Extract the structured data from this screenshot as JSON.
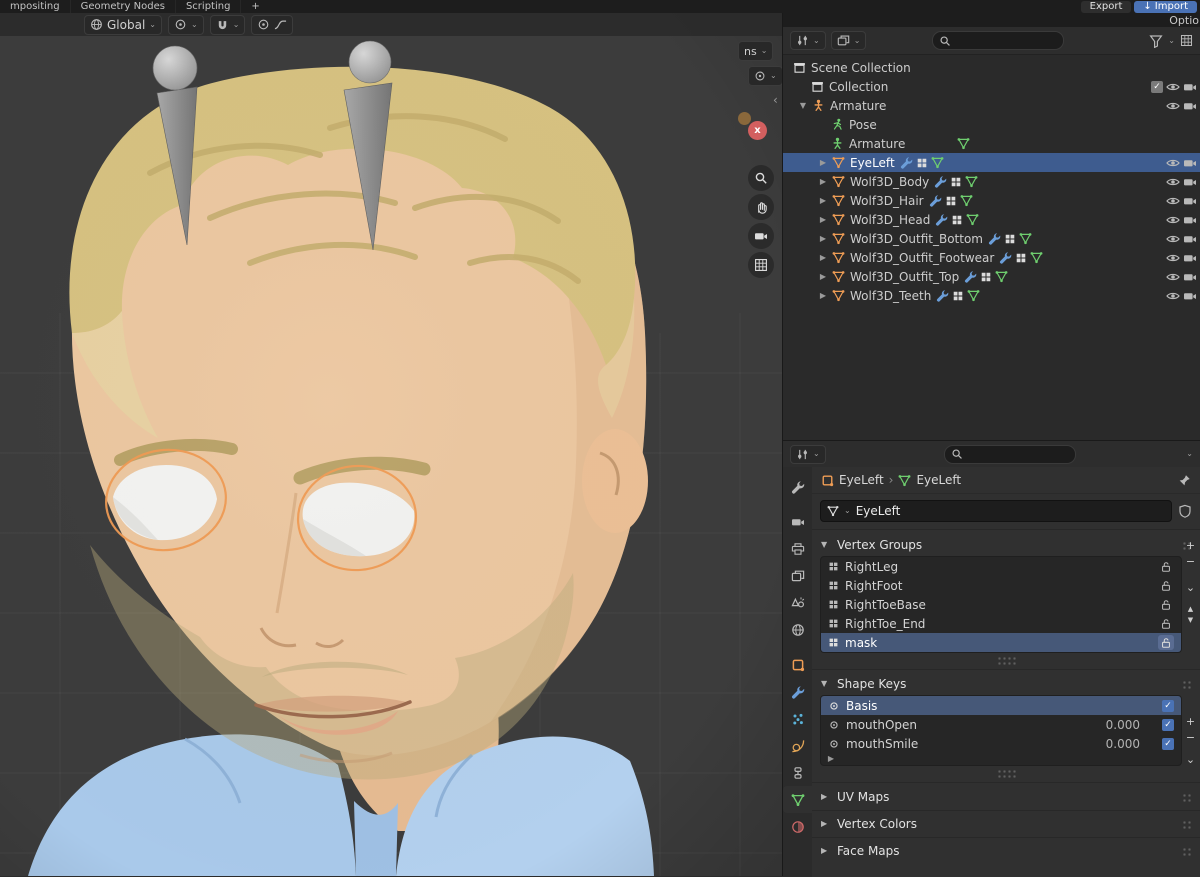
{
  "glyphs": {
    "caret": "⌄",
    "disc_open": "▼",
    "disc_closed": "▶",
    "plus": "+",
    "minus": "−",
    "arrow_up": "▲",
    "arrow_down": "▼",
    "chev_right": "›",
    "chev_left": "‹",
    "check": "✓",
    "x_axis": "x",
    "import_arrow": "↓"
  },
  "colors": {
    "selection_blue": "#3e5c8f",
    "accent_orange": "#ef9d55",
    "data_green": "#6fcf6f",
    "import_button": "#4a72b5"
  },
  "topbar": {
    "tabs": [
      "mpositing",
      "Geometry Nodes",
      "Scripting",
      "+"
    ],
    "export_label": "Export",
    "import_label": "Import",
    "options_label": "Optio"
  },
  "viewport": {
    "orientation_label": "Global",
    "corner_label": "ns"
  },
  "outliner": {
    "rows": [
      {
        "label": "Scene Collection"
      },
      {
        "label": "Collection"
      },
      {
        "label": "Armature"
      },
      {
        "label": "Pose"
      },
      {
        "label": "Armature"
      },
      {
        "label": "EyeLeft"
      },
      {
        "label": "Wolf3D_Body"
      },
      {
        "label": "Wolf3D_Hair"
      },
      {
        "label": "Wolf3D_Head"
      },
      {
        "label": "Wolf3D_Outfit_Bottom"
      },
      {
        "label": "Wolf3D_Outfit_Footwear"
      },
      {
        "label": "Wolf3D_Outfit_Top"
      },
      {
        "label": "Wolf3D_Teeth"
      }
    ]
  },
  "properties": {
    "breadcrumb_object": "EyeLeft",
    "breadcrumb_data": "EyeLeft",
    "name_value": "EyeLeft",
    "panels": {
      "vertex_groups_title": "Vertex Groups",
      "shape_keys_title": "Shape Keys",
      "uv_maps_title": "UV Maps",
      "vertex_colors_title": "Vertex Colors",
      "face_maps_title": "Face Maps"
    },
    "vertex_groups": [
      {
        "name": "RightLeg"
      },
      {
        "name": "RightFoot"
      },
      {
        "name": "RightToeBase"
      },
      {
        "name": "RightToe_End"
      },
      {
        "name": "mask"
      }
    ],
    "shape_keys": [
      {
        "name": "Basis",
        "value": ""
      },
      {
        "name": "mouthOpen",
        "value": "0.000"
      },
      {
        "name": "mouthSmile",
        "value": "0.000"
      }
    ]
  }
}
